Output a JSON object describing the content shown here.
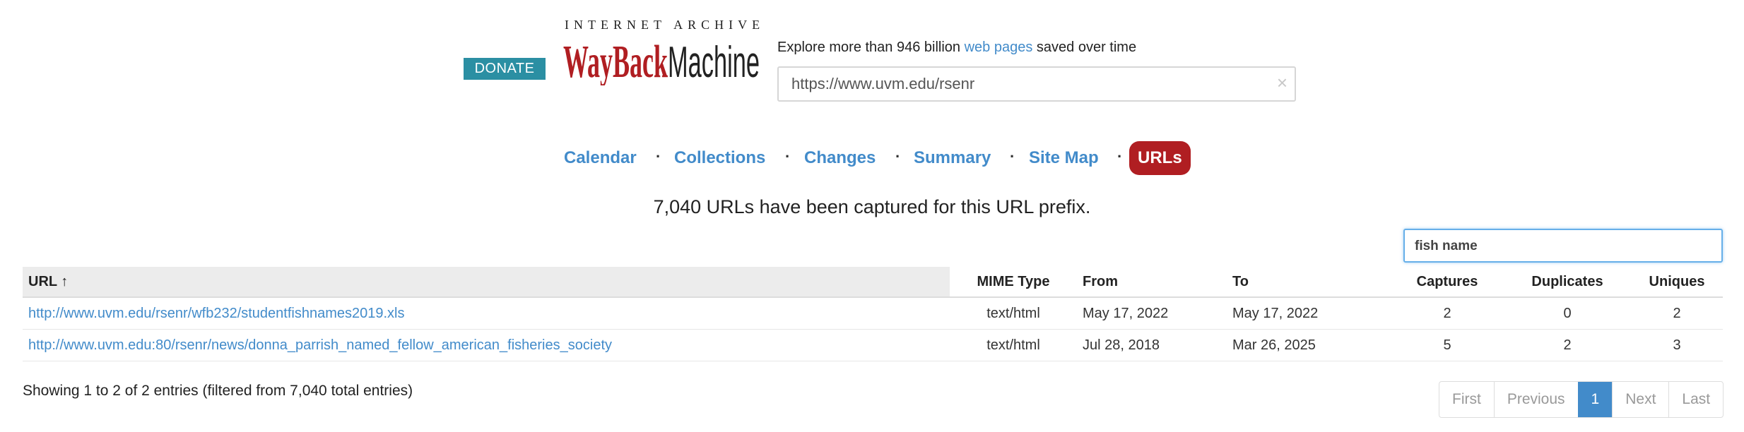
{
  "header": {
    "donate_label": "DONATE",
    "logo_top": "INTERNET ARCHIVE",
    "logo_wayback": "WayBack",
    "logo_machine": "Machine",
    "explore_prefix": "Explore more than 946 billion ",
    "explore_link": "web pages",
    "explore_suffix": " saved over time",
    "search_value": "https://www.uvm.edu/rsenr",
    "clear_glyph": "×"
  },
  "tabs": {
    "calendar": "Calendar",
    "collections": "Collections",
    "changes": "Changes",
    "summary": "Summary",
    "site_map": "Site Map",
    "urls": "URLs",
    "separator": "·"
  },
  "summary_text": "7,040 URLs have been captured for this URL prefix.",
  "filter": {
    "value": "fish name"
  },
  "table": {
    "headers": {
      "url": "URL ↑",
      "mime": "MIME Type",
      "from": "From",
      "to": "To",
      "captures": "Captures",
      "duplicates": "Duplicates",
      "uniques": "Uniques"
    },
    "rows": [
      {
        "url": "http://www.uvm.edu/rsenr/wfb232/studentfishnames2019.xls",
        "mime": "text/html",
        "from": "May 17, 2022",
        "to": "May 17, 2022",
        "captures": "2",
        "duplicates": "0",
        "uniques": "2"
      },
      {
        "url": "http://www.uvm.edu:80/rsenr/news/donna_parrish_named_fellow_american_fisheries_society",
        "mime": "text/html",
        "from": "Jul 28, 2018",
        "to": "Mar 26, 2025",
        "captures": "5",
        "duplicates": "2",
        "uniques": "3"
      }
    ]
  },
  "info_text": "Showing 1 to 2 of 2 entries (filtered from 7,040 total entries)",
  "pager": {
    "first": "First",
    "previous": "Previous",
    "current": "1",
    "next": "Next",
    "last": "Last"
  },
  "colors": {
    "accent": "#428bca",
    "active_tab": "#b01e22",
    "donate": "#2b8fa3"
  }
}
